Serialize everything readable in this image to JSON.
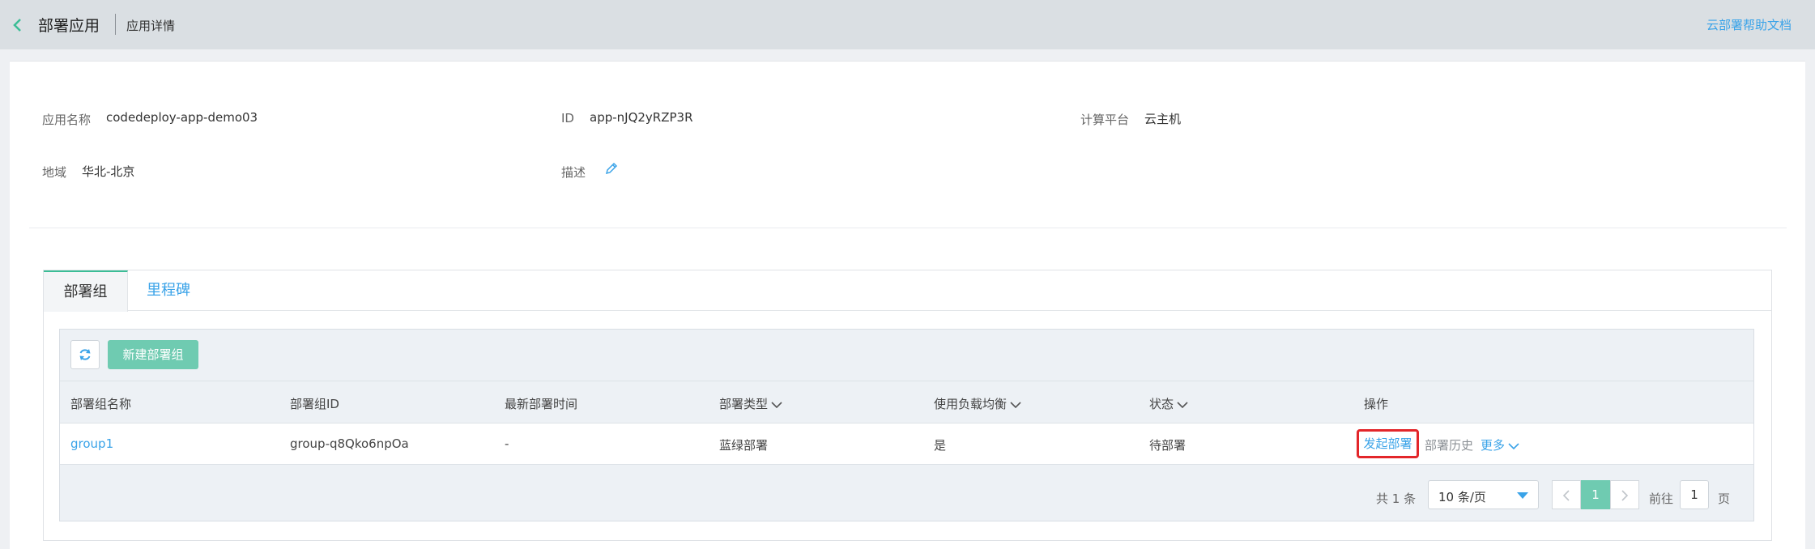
{
  "header": {
    "title": "部署应用",
    "breadcrumb": "应用详情",
    "help_link": "云部署帮助文档"
  },
  "info": {
    "app_name_label": "应用名称",
    "app_name_value": "codedeploy-app-demo03",
    "id_label": "ID",
    "id_value": "app-nJQ2yRZP3R",
    "platform_label": "计算平台",
    "platform_value": "云主机",
    "region_label": "地域",
    "region_value": "华北-北京",
    "desc_label": "描述"
  },
  "tabs": [
    {
      "label": "部署组",
      "active": true
    },
    {
      "label": "里程碑",
      "active": false
    }
  ],
  "toolbar": {
    "new_group_label": "新建部署组"
  },
  "table": {
    "columns": [
      "部署组名称",
      "部署组ID",
      "最新部署时间",
      "部署类型",
      "使用负载均衡",
      "状态",
      "操作"
    ],
    "rows": [
      {
        "name": "group1",
        "group_id": "group-q8Qko6npOa",
        "last_deploy_time": "-",
        "deploy_type": "蓝绿部署",
        "load_balancer": "是",
        "status": "待部署",
        "actions": [
          "发起部署",
          "部署历史",
          "更多"
        ]
      }
    ]
  },
  "pagination": {
    "total": "共 1 条",
    "page_size": "10 条/页",
    "current_page": "1",
    "goto_label": "前往",
    "goto_value": "1",
    "page_unit": "页"
  },
  "colors": {
    "accent": "#3bbd96",
    "link": "#3aa3e8",
    "highlight_border": "#e3262a"
  }
}
